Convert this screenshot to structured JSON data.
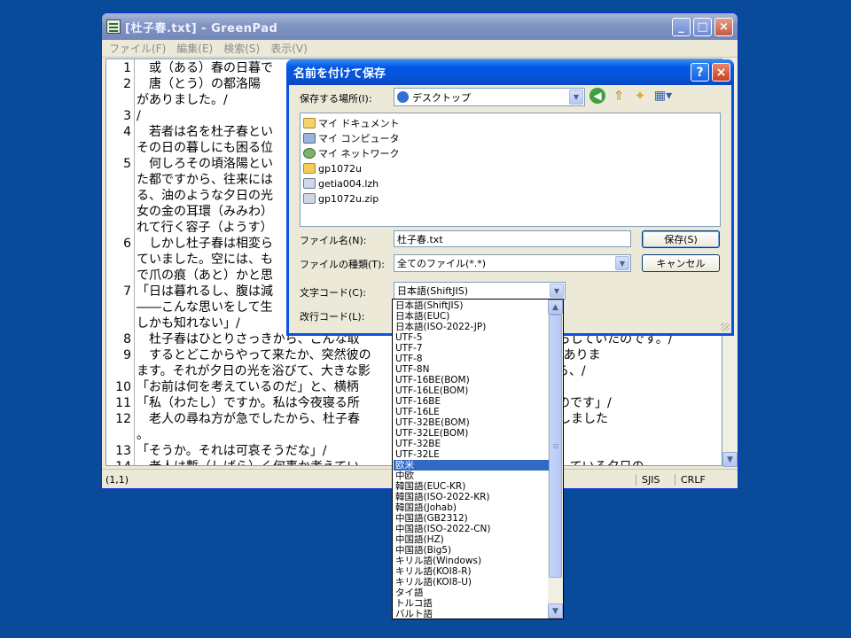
{
  "main_window": {
    "title": "[杜子春.txt] - GreenPad",
    "menu": [
      "ファイル(F)",
      "編集(E)",
      "検索(S)",
      "表示(V)"
    ],
    "lines": [
      {
        "num": "1",
        "text": "　或（ある）春の日暮で"
      },
      {
        "num": "2",
        "text": "　唐（とう）の都洛陽"
      },
      {
        "num": "",
        "text": "がありました。/"
      },
      {
        "num": "3",
        "text": "/"
      },
      {
        "num": "4",
        "text": "　若者は名を杜子春とい"
      },
      {
        "num": "",
        "text": "その日の暮しにも困る位"
      },
      {
        "num": "5",
        "text": "　何しろその頃洛陽とい"
      },
      {
        "num": "",
        "text": "た都ですから、往来には"
      },
      {
        "num": "",
        "text": "る、油のような夕日の光"
      },
      {
        "num": "",
        "text": "女の金の耳環（みみわ）"
      },
      {
        "num": "",
        "text": "れて行く容子（ようす）"
      },
      {
        "num": "6",
        "text": "　しかし杜子春は相変ら"
      },
      {
        "num": "",
        "text": "ていました。空には、も"
      },
      {
        "num": "",
        "text": "で爪の痕（あと）かと思"
      },
      {
        "num": "7",
        "text": "「日は暮れるし、腹は減"
      },
      {
        "num": "",
        "text": "――こんな思いをして生"
      },
      {
        "num": "",
        "text": "しかも知れない」/"
      },
      {
        "num": "8",
        "text": "　杜子春はひとりさっきから、こんな取　　　　　　　　　　　　　　　くらしていたのです。/"
      },
      {
        "num": "9",
        "text": "　するとどこからやって来たか、突然彼の　　　　　　　（すがめ）の老人がありま"
      },
      {
        "num": "",
        "text": "ます。それが夕日の光を浴びて、大きな影　　　　　　　子春の顔を見ながら、/"
      },
      {
        "num": "10",
        "text": "「お前は何を考えているのだ」と、横柄"
      },
      {
        "num": "11",
        "text": "「私（わたし）ですか。私は今夜寝る所　　　　　　　　　かと考えているのです」/"
      },
      {
        "num": "12",
        "text": "　老人の尋ね方が急でしたから、杜子春　　　　　　　　　わず正直な答をしました"
      },
      {
        "num": "",
        "text": "。"
      },
      {
        "num": "13",
        "text": "「そうか。それは可哀そうだな」/"
      },
      {
        "num": "14",
        "text": "　老人は暫（しばら）く何事か考えてい　　　　　　　　　　　　な主にさしている夕日の"
      }
    ],
    "status": {
      "position": "(1,1)",
      "encoding": "SJIS",
      "eol": "CRLF"
    }
  },
  "save_dialog": {
    "title": "名前を付けて保存",
    "help_label": "?",
    "close_label": "×",
    "location_label": "保存する場所(I):",
    "location_value": "デスクトップ",
    "files": [
      {
        "name": "マイ ドキュメント",
        "icon": "my-documents-icon"
      },
      {
        "name": "マイ コンピュータ",
        "icon": "my-computer-icon"
      },
      {
        "name": "マイ ネットワーク",
        "icon": "my-network-icon"
      },
      {
        "name": "gp1072u",
        "icon": "folder-icon"
      },
      {
        "name": "getia004.lzh",
        "icon": "archive-icon"
      },
      {
        "name": "gp1072u.zip",
        "icon": "zip-icon"
      }
    ],
    "filename_label": "ファイル名(N):",
    "filename_value": "杜子春.txt",
    "filetype_label": "ファイルの種類(T):",
    "filetype_value": "全てのファイル(*.*)",
    "charcode_label": "文字コード(C):",
    "charcode_value": "日本語(ShiftJIS)",
    "linebreak_label": "改行コード(L):",
    "save_button": "保存(S)",
    "cancel_button": "キャンセル"
  },
  "charcode_options": [
    "日本語(ShiftJIS)",
    "日本語(EUC)",
    "日本語(ISO-2022-JP)",
    "UTF-5",
    "UTF-7",
    "UTF-8",
    "UTF-8N",
    "UTF-16BE(BOM)",
    "UTF-16LE(BOM)",
    "UTF-16BE",
    "UTF-16LE",
    "UTF-32BE(BOM)",
    "UTF-32LE(BOM)",
    "UTF-32BE",
    "UTF-32LE",
    "欧米",
    "中欧",
    "韓国語(EUC-KR)",
    "韓国語(ISO-2022-KR)",
    "韓国語(Johab)",
    "中国語(GB2312)",
    "中国語(ISO-2022-CN)",
    "中国語(HZ)",
    "中国語(Big5)",
    "キリル語(Windows)",
    "キリル語(KOI8-R)",
    "キリル語(KOI8-U)",
    "タイ語",
    "トルコ語",
    "バルト語"
  ],
  "charcode_selected": "欧米",
  "icons": {
    "back": "back-arrow-icon",
    "up": "up-folder-icon",
    "new_folder": "new-folder-icon",
    "view": "view-menu-icon"
  }
}
